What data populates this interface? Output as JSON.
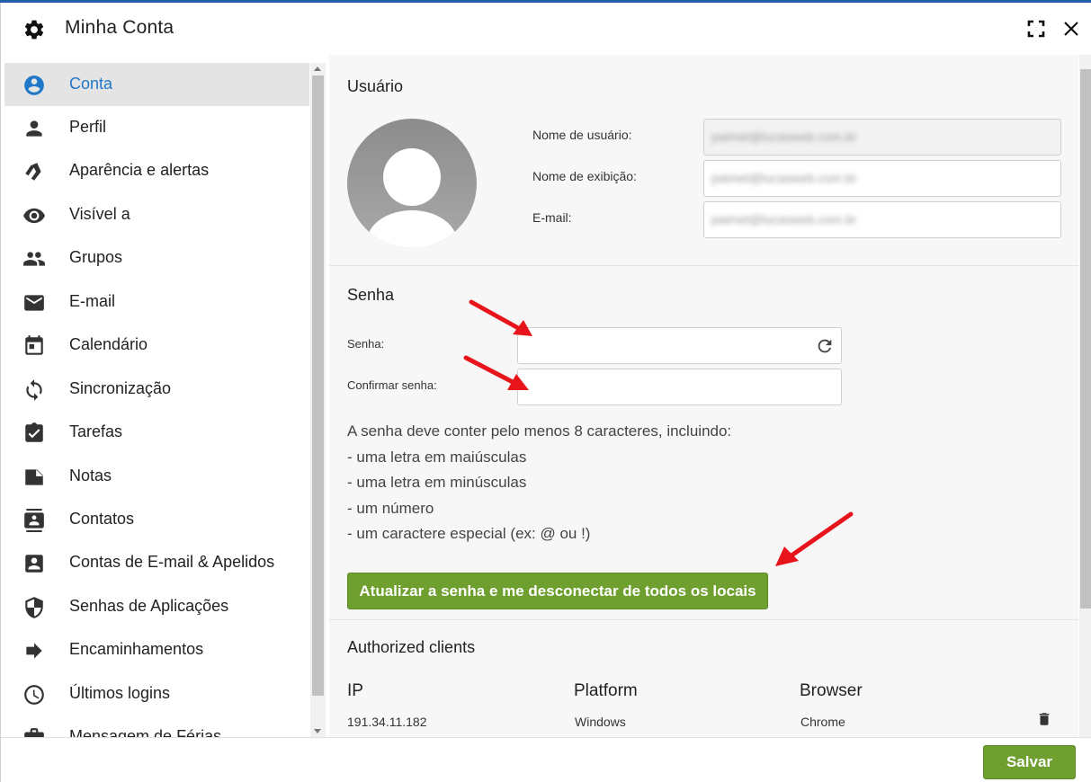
{
  "window": {
    "title": "Minha Conta",
    "icon": "gear-icon"
  },
  "sidebar": {
    "items": [
      {
        "label": "Conta",
        "icon": "account-circle-icon",
        "active": true
      },
      {
        "label": "Perfil",
        "icon": "person-icon"
      },
      {
        "label": "Aparência e alertas",
        "icon": "palette-icon"
      },
      {
        "label": "Visível a",
        "icon": "eye-icon"
      },
      {
        "label": "Grupos",
        "icon": "group-icon"
      },
      {
        "label": "E-mail",
        "icon": "mail-icon"
      },
      {
        "label": "Calendário",
        "icon": "calendar-icon"
      },
      {
        "label": "Sincronização",
        "icon": "sync-icon"
      },
      {
        "label": "Tarefas",
        "icon": "task-icon"
      },
      {
        "label": "Notas",
        "icon": "note-icon"
      },
      {
        "label": "Contatos",
        "icon": "contacts-icon"
      },
      {
        "label": "Contas de E-mail & Apelidos",
        "icon": "account-box-icon"
      },
      {
        "label": "Senhas de Aplicações",
        "icon": "shield-icon"
      },
      {
        "label": "Encaminhamentos",
        "icon": "arrow-right-icon"
      },
      {
        "label": "Últimos logins",
        "icon": "clock-icon"
      },
      {
        "label": "Mensagem de Férias",
        "icon": "briefcase-icon"
      }
    ]
  },
  "user_section": {
    "title": "Usuário",
    "username_label": "Nome de usuário:",
    "username_value": "paimet@lucasweb.com.br",
    "display_name_label": "Nome de exibição:",
    "display_name_value": "paimet@lucasweb.com.br",
    "email_label": "E-mail:",
    "email_value": "paimet@lucasweb.com.br"
  },
  "password_section": {
    "title": "Senha",
    "password_label": "Senha:",
    "password_value": "",
    "confirm_label": "Confirmar senha:",
    "confirm_value": "",
    "rules": [
      "A senha deve conter pelo menos 8 caracteres, incluindo:",
      "- uma letra em maiúsculas",
      "- uma letra em minúsculas",
      "- um número",
      "- um caractere especial (ex: @ ou !)"
    ],
    "update_button": "Atualizar a senha e me desconectar de todos os locais"
  },
  "clients_section": {
    "title": "Authorized clients",
    "columns": [
      "IP",
      "Platform",
      "Browser"
    ],
    "rows": [
      {
        "ip": "191.34.11.182",
        "platform": "Windows",
        "browser": "Chrome"
      }
    ]
  },
  "footer": {
    "save_label": "Salvar"
  },
  "colors": {
    "accent": "#1f78c8",
    "button_green": "#6e9f2f",
    "annotation_red": "#e8141b"
  }
}
